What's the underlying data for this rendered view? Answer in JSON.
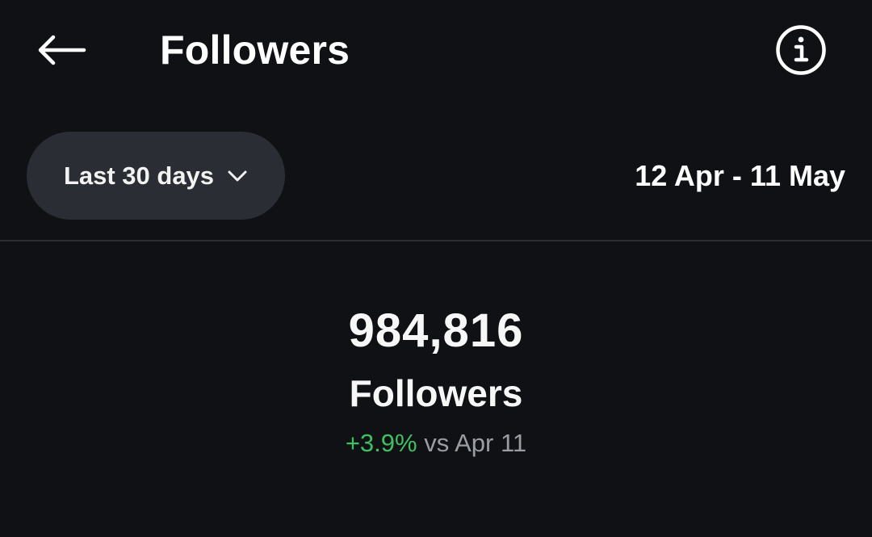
{
  "header": {
    "title": "Followers",
    "back_icon": "arrow-left-icon",
    "info_icon": "info-icon"
  },
  "filter": {
    "range_label": "Last 30 days",
    "dropdown_icon": "chevron-down-icon",
    "date_range": "12 Apr - 11 May"
  },
  "summary": {
    "count": "984,816",
    "label": "Followers",
    "change_pct": "+3.9%",
    "change_suffix": " vs Apr 11"
  },
  "colors": {
    "background": "#0f1115",
    "pill": "#2a2d33",
    "positive": "#3fbf5f",
    "muted_text": "#9a9da3"
  }
}
